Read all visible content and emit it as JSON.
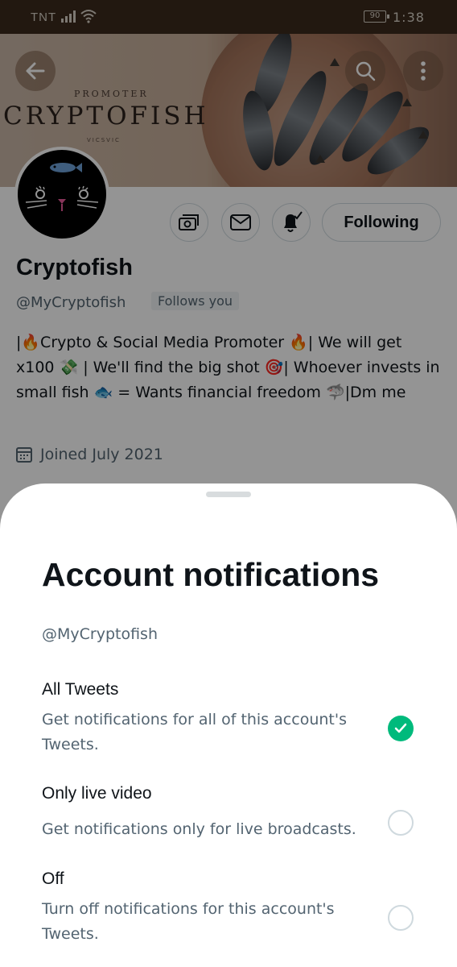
{
  "status_bar": {
    "carrier": "TNT",
    "battery": "90",
    "time": "1:38"
  },
  "banner": {
    "promoter": "PROMOTER",
    "brand": "CRYPTOFISH",
    "credit": "VICSVIC"
  },
  "profile": {
    "follow_button": "Following",
    "name": "Cryptofish",
    "handle": "@MyCryptofish",
    "follows_you": "Follows you",
    "bio": "|🔥Crypto & Social Media Promoter 🔥| We will get x100 💸 | We'll find the big shot 🎯| Whoever invests in small fish 🐟 = Wants financial freedom 🦈|Dm me",
    "joined": "Joined July 2021"
  },
  "sheet": {
    "title": "Account notifications",
    "handle": "@MyCryptofish",
    "options": [
      {
        "title": "All Tweets",
        "description": "Get notifications for all of this account's Tweets.",
        "selected": true
      },
      {
        "title": "Only live video",
        "description": "Get notifications only for live broadcasts.",
        "selected": false
      },
      {
        "title": "Off",
        "description": "Turn off notifications for this account's Tweets.",
        "selected": false
      }
    ]
  },
  "colors": {
    "accent_green": "#00ba7c",
    "secondary_text": "#536471",
    "status_bar": "#3b2a1c"
  }
}
